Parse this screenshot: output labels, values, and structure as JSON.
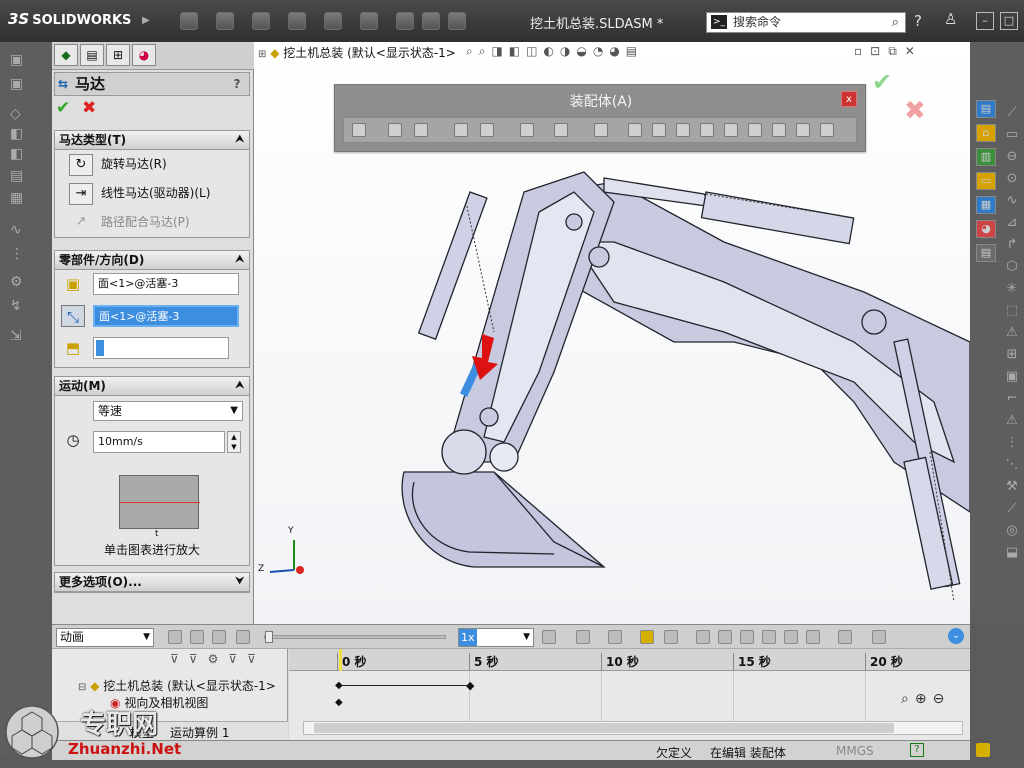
{
  "app": {
    "logo": "SOLIDWORKS",
    "document_title": "挖土机总装.SLDASM *"
  },
  "search": {
    "placeholder": "搜索命令"
  },
  "property_manager": {
    "title": "马达",
    "help": "?",
    "motor_type": {
      "header": "马达类型(T)",
      "options": [
        {
          "label": "旋转马达(R)",
          "icon": "rotary-motor-icon"
        },
        {
          "label": "线性马达(驱动器)(L)",
          "icon": "linear-motor-icon"
        },
        {
          "label": "路径配合马达(P)",
          "icon": "path-mate-motor-icon"
        }
      ]
    },
    "component_direction": {
      "header": "零部件/方向(D)",
      "field1": "面<1>@活塞-3",
      "field2": "面<1>@活塞-3",
      "field3": ""
    },
    "motion": {
      "header": "运动(M)",
      "type": "等速",
      "speed": "10mm/s",
      "graph_x_label": "t",
      "graph_caption": "单击图表进行放大"
    },
    "more_options": {
      "header": "更多选项(O)..."
    }
  },
  "feature_tree": {
    "label": "挖土机总装  (默认<显示状态-1>"
  },
  "assembly_toolbar": {
    "title": "装配体(A)"
  },
  "motion_study": {
    "type": "动画",
    "speed": "1x",
    "time_labels": [
      "0 秒",
      "5 秒",
      "10 秒",
      "15 秒",
      "20 秒"
    ],
    "tree_root": "挖土机总装  (默认<显示状态-1>",
    "tree_child": "视向及相机视图",
    "tabs": [
      "模型",
      "运动算例 1"
    ]
  },
  "status_bar": {
    "underdefined": "欠定义",
    "editing": "在编辑 装配体",
    "units": "MMGS"
  },
  "axes": {
    "y": "Y",
    "z": "Z"
  },
  "watermark": {
    "text": "专职网",
    "url": "Zhuanzhi.Net"
  },
  "colors": {
    "accent_blue": "#3e8ee0",
    "titlebar": "#3a3a3a",
    "check_green": "#2aa82a",
    "cancel_red": "#d22"
  }
}
